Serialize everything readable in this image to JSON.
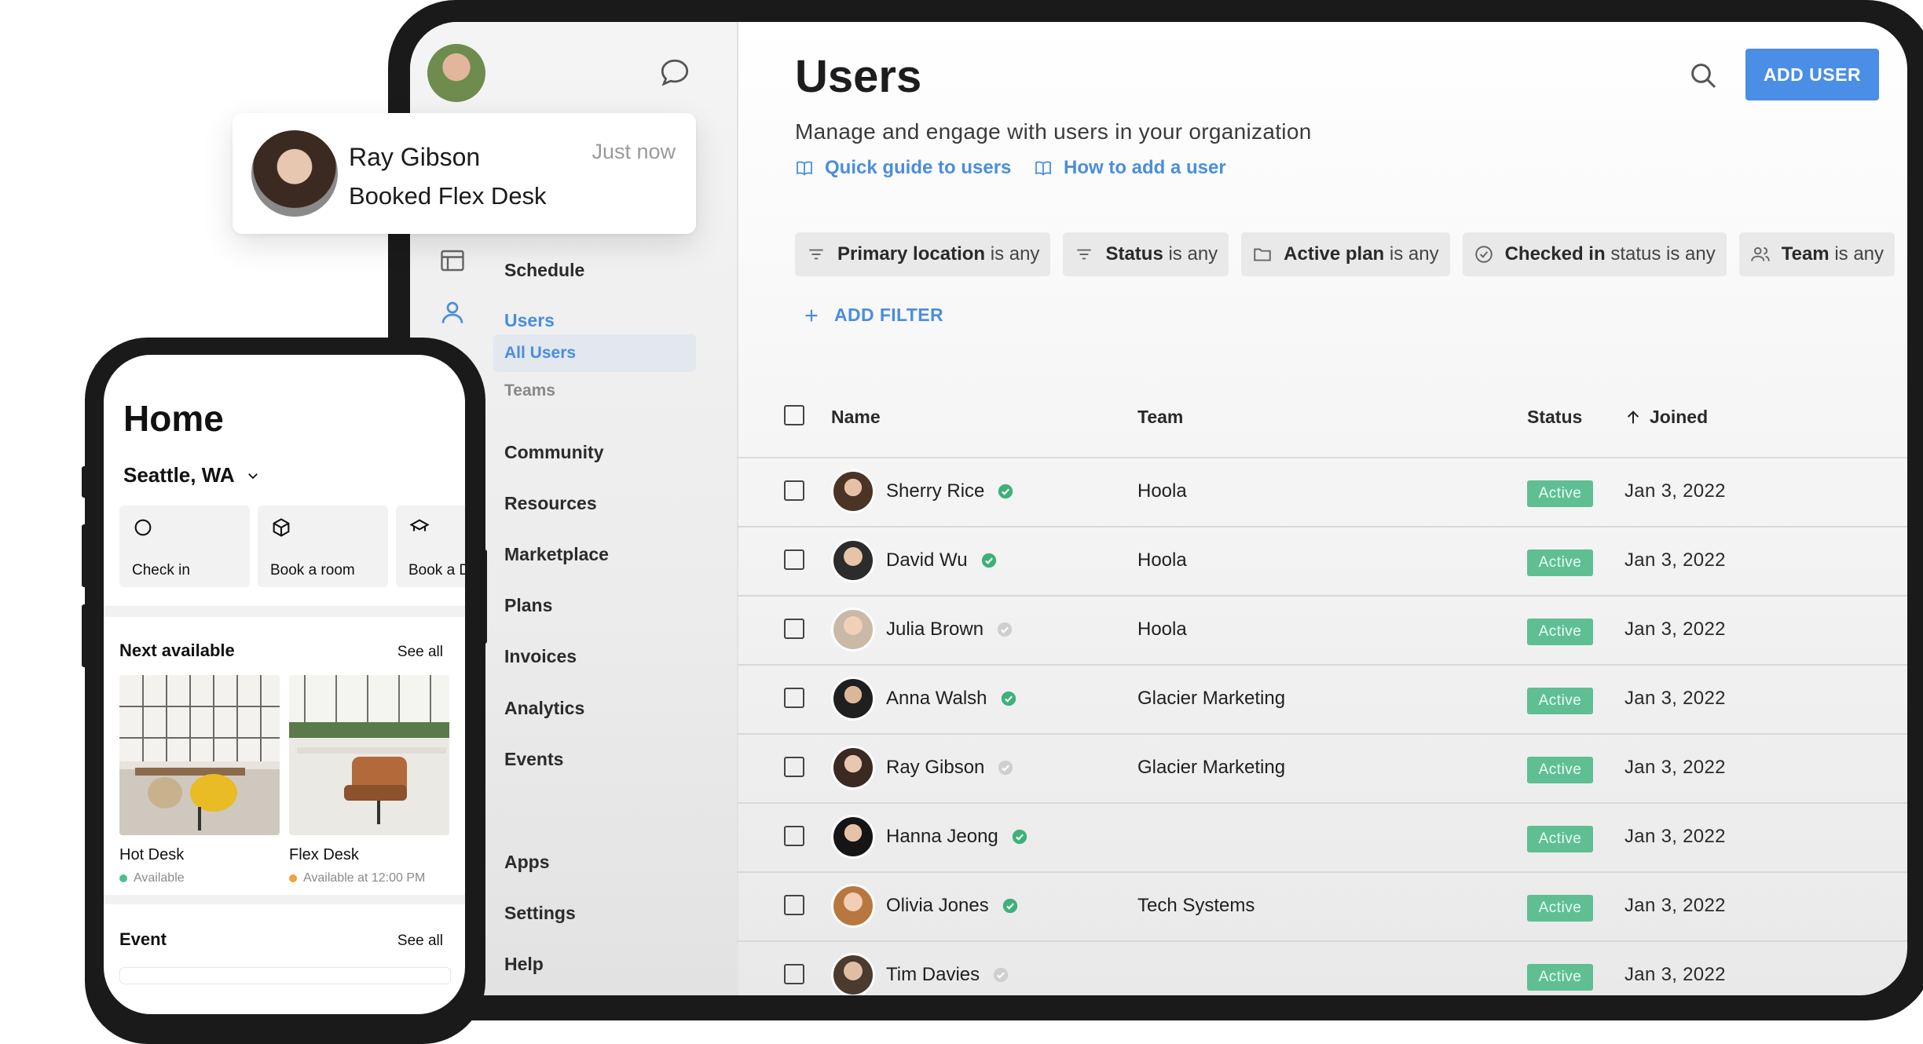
{
  "sidebar": {
    "items": [
      {
        "label": "Schedule"
      },
      {
        "label": "Users"
      },
      {
        "label": "Community"
      },
      {
        "label": "Resources"
      },
      {
        "label": "Marketplace"
      },
      {
        "label": "Plans"
      },
      {
        "label": "Invoices"
      },
      {
        "label": "Analytics"
      },
      {
        "label": "Events"
      },
      {
        "label": "Apps"
      },
      {
        "label": "Settings"
      },
      {
        "label": "Help"
      }
    ],
    "subitems": [
      {
        "label": "All Users"
      },
      {
        "label": "Teams"
      }
    ]
  },
  "header": {
    "title": "Users",
    "add_user_label": "ADD USER",
    "subtitle": "Manage and engage with users in your organization",
    "links": [
      {
        "label": "Quick guide to users"
      },
      {
        "label": "How to add a user"
      }
    ]
  },
  "filters": [
    {
      "field": "Primary location",
      "cond": "is any"
    },
    {
      "field": "Status",
      "cond": "is any"
    },
    {
      "field": "Active plan",
      "cond": "is any"
    },
    {
      "field": "Checked in",
      "cond": "status is any"
    },
    {
      "field": "Team",
      "cond": "is any"
    }
  ],
  "add_filter_label": "ADD FILTER",
  "table": {
    "columns": [
      "Name",
      "Team",
      "Status",
      "Joined"
    ],
    "rows": [
      {
        "name": "Sherry Rice",
        "verified": true,
        "team": "Hoola",
        "status": "Active",
        "joined": "Jan 3, 2022"
      },
      {
        "name": "David Wu",
        "verified": true,
        "team": "Hoola",
        "status": "Active",
        "joined": "Jan 3, 2022"
      },
      {
        "name": "Julia Brown",
        "verified": false,
        "team": "Hoola",
        "status": "Active",
        "joined": "Jan 3, 2022"
      },
      {
        "name": "Anna Walsh",
        "verified": true,
        "team": "Glacier Marketing",
        "status": "Active",
        "joined": "Jan 3, 2022"
      },
      {
        "name": "Ray Gibson",
        "verified": false,
        "team": "Glacier Marketing",
        "status": "Active",
        "joined": "Jan 3, 2022"
      },
      {
        "name": "Hanna Jeong",
        "verified": true,
        "team": "",
        "status": "Active",
        "joined": "Jan 3, 2022"
      },
      {
        "name": "Olivia Jones",
        "verified": true,
        "team": "Tech Systems",
        "status": "Active",
        "joined": "Jan 3, 2022"
      },
      {
        "name": "Tim Davies",
        "verified": false,
        "team": "",
        "status": "Active",
        "joined": "Jan 3, 2022"
      }
    ]
  },
  "notification": {
    "name": "Ray Gibson",
    "time": "Just now",
    "message": "Booked Flex Desk"
  },
  "phone": {
    "title": "Home",
    "location": "Seattle, WA",
    "actions": [
      {
        "label": "Check in",
        "icon": "circle-icon"
      },
      {
        "label": "Book a room",
        "icon": "cube-icon"
      },
      {
        "label": "Book a D",
        "icon": "desk-icon"
      }
    ],
    "next_available": {
      "title": "Next available",
      "see_all": "See all",
      "cards": [
        {
          "title": "Hot Desk",
          "availability": "Available",
          "dot_color": "#4cc08c"
        },
        {
          "title": "Flex Desk",
          "availability": "Available at 12:00 PM",
          "dot_color": "#f0a23c"
        }
      ]
    },
    "event": {
      "title": "Event",
      "see_all": "See all"
    }
  },
  "colors": {
    "accent": "#4a8ddf",
    "button": "#4a8ee6",
    "status_active": "#5fbf92",
    "verified": "#3fb07a"
  }
}
